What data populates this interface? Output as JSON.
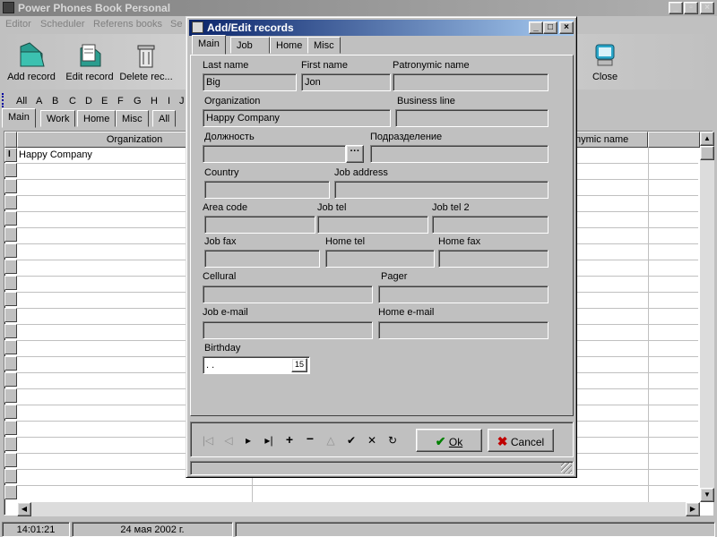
{
  "app": {
    "title": "Power Phones Book Personal",
    "menu": [
      "Editor",
      "Scheduler",
      "Referens books",
      "Se"
    ],
    "toolbar": {
      "add_record": "Add record",
      "edit_record": "Edit record",
      "delete_record": "Delete rec...",
      "close": "Close"
    },
    "alphabet": [
      "All",
      "A",
      "B",
      "C",
      "D",
      "E",
      "F",
      "G",
      "H",
      "I",
      "J"
    ],
    "tabs": [
      "Main",
      "Work",
      "Home",
      "Misc",
      "All"
    ],
    "grid": {
      "col_organization": "Organization",
      "col_name": "nymic name",
      "rows": [
        {
          "organization": "Happy Company"
        }
      ]
    },
    "status": {
      "time": "14:01:21",
      "date": "24 мая 2002 г."
    },
    "window_buttons": {
      "min": "_",
      "max": "▫",
      "close": "×"
    }
  },
  "dialog": {
    "title": "Add/Edit records",
    "tabs": [
      "Main",
      "Job",
      "Home",
      "Misc"
    ],
    "fields": {
      "last_name": {
        "label": "Last name",
        "value": "Big"
      },
      "first_name": {
        "label": "First name",
        "value": "Jon"
      },
      "patronymic": {
        "label": "Patronymic name",
        "value": ""
      },
      "organization": {
        "label": "Organization",
        "value": "Happy Company"
      },
      "business_line": {
        "label": "Business line",
        "value": ""
      },
      "position": {
        "label": "Должность",
        "value": ""
      },
      "department": {
        "label": "Подразделение",
        "value": ""
      },
      "country": {
        "label": "Country",
        "value": ""
      },
      "job_address": {
        "label": "Job address",
        "value": ""
      },
      "area_code": {
        "label": "Area code",
        "value": ""
      },
      "job_tel": {
        "label": "Job tel",
        "value": ""
      },
      "job_tel2": {
        "label": "Job tel 2",
        "value": ""
      },
      "job_fax": {
        "label": "Job fax",
        "value": ""
      },
      "home_tel": {
        "label": "Home tel",
        "value": ""
      },
      "home_fax": {
        "label": "Home fax",
        "value": ""
      },
      "cellular": {
        "label": "Cellural",
        "value": ""
      },
      "pager": {
        "label": "Pager",
        "value": ""
      },
      "job_email": {
        "label": "Job e-mail",
        "value": ""
      },
      "home_email": {
        "label": "Home e-mail",
        "value": ""
      },
      "birthday": {
        "label": "Birthday",
        "value": " .  ."
      }
    },
    "ellipsis": "···",
    "calendar_day": "15",
    "ok_label": "Ok",
    "cancel_label": "Cancel",
    "window_buttons": {
      "min": "_",
      "max": "□",
      "close": "×"
    }
  },
  "colors": {
    "title_active": "#0a246a",
    "ok_check": "#008000",
    "cancel_x": "#c00000"
  }
}
